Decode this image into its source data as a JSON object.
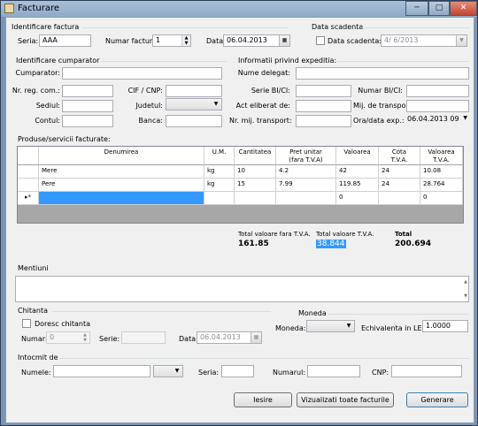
{
  "window": {
    "title": "Facturare",
    "min": "─",
    "max": "□",
    "close": "✕"
  },
  "identificare_factura": {
    "group_title": "Identificare factura",
    "seria_label": "Seria:",
    "seria_value": "AAA",
    "numar_label": "Numar factura:",
    "numar_value": "1",
    "data_label": "Data:",
    "data_value": "06.04.2013"
  },
  "data_scadenta": {
    "group_title": "Data scadenta",
    "checkbox_label": "Data scadenta:",
    "value": "4/  6/2013"
  },
  "cumparator": {
    "group_title": "Identificare cumparator",
    "cumparator_label": "Cumparator:",
    "nr_reg_label": "Nr. reg. com.:",
    "cif_label": "CIF / CNP:",
    "sediul_label": "Sediul:",
    "judetul_label": "Judetul:",
    "contul_label": "Contul:",
    "banca_label": "Banca:"
  },
  "expeditie": {
    "group_title": "Informatii privind expeditia:",
    "delegat_label": "Nume delegat:",
    "serie_bi_label": "Serie BI/CI:",
    "numar_bi_label": "Numar BI/CI:",
    "act_label": "Act eliberat de:",
    "mij_label": "Mij. de transport:",
    "nr_mij_label": "Nr. mij. transport:",
    "ora_label": "Ora/data exp.:",
    "ora_value": "06.04.2013 09"
  },
  "produse": {
    "group_title": "Produse/servicii facturate:",
    "columns": [
      {
        "l1": "Denumirea",
        "l2": ""
      },
      {
        "l1": "U.M.",
        "l2": ""
      },
      {
        "l1": "Cantitatea",
        "l2": ""
      },
      {
        "l1": "Pret unitar",
        "l2": "(fara T.V.A)"
      },
      {
        "l1": "Valoarea",
        "l2": ""
      },
      {
        "l1": "Cota",
        "l2": "T.V.A."
      },
      {
        "l1": "Valoarea",
        "l2": "T.V.A."
      }
    ],
    "rows": [
      [
        "Mere",
        "kg",
        "10",
        "4.2",
        "42",
        "24",
        "10.08"
      ],
      [
        "Pere",
        "kg",
        "15",
        "7.99",
        "119.85",
        "24",
        "28.764"
      ]
    ],
    "new_row_marker": "▸*",
    "new_row": [
      "",
      "",
      "",
      "",
      "0",
      "",
      "0"
    ]
  },
  "totals": {
    "fara_tva_label": "Total valoare fara T.V.A.",
    "fara_tva_value": "161.85",
    "tva_label": "Total valoare T.V.A.",
    "tva_value": "38.844",
    "total_label": "Total",
    "total_value": "200.694"
  },
  "mentiuni": {
    "group_title": "Mentiuni",
    "scroll_up": "▲",
    "scroll_down": "▼"
  },
  "chitanta": {
    "group_title": "Chitanta",
    "checkbox_label": "Doresc chitanta",
    "numar_label": "Numar:",
    "numar_value": "0",
    "serie_label": "Serie:",
    "data_label": "Data:",
    "data_value": "06.04.2013"
  },
  "moneda": {
    "group_title": "Moneda",
    "moneda_label": "Moneda:",
    "echivalenta_label": "Echivalenta in LEI:",
    "echivalenta_value": "1.0000"
  },
  "intocmit": {
    "group_title": "Intocmit de",
    "numele_label": "Numele:",
    "seria_label": "Seria:",
    "numarul_label": "Numarul:",
    "cnp_label": "CNP:"
  },
  "buttons": {
    "iesire": "Iesire",
    "vizualizati": "Vizualizati toate facturile",
    "generare": "Generare"
  },
  "icons": {
    "dropdown": "▼",
    "spin_up": "▲",
    "spin_down": "▼",
    "calendar": "▦"
  }
}
